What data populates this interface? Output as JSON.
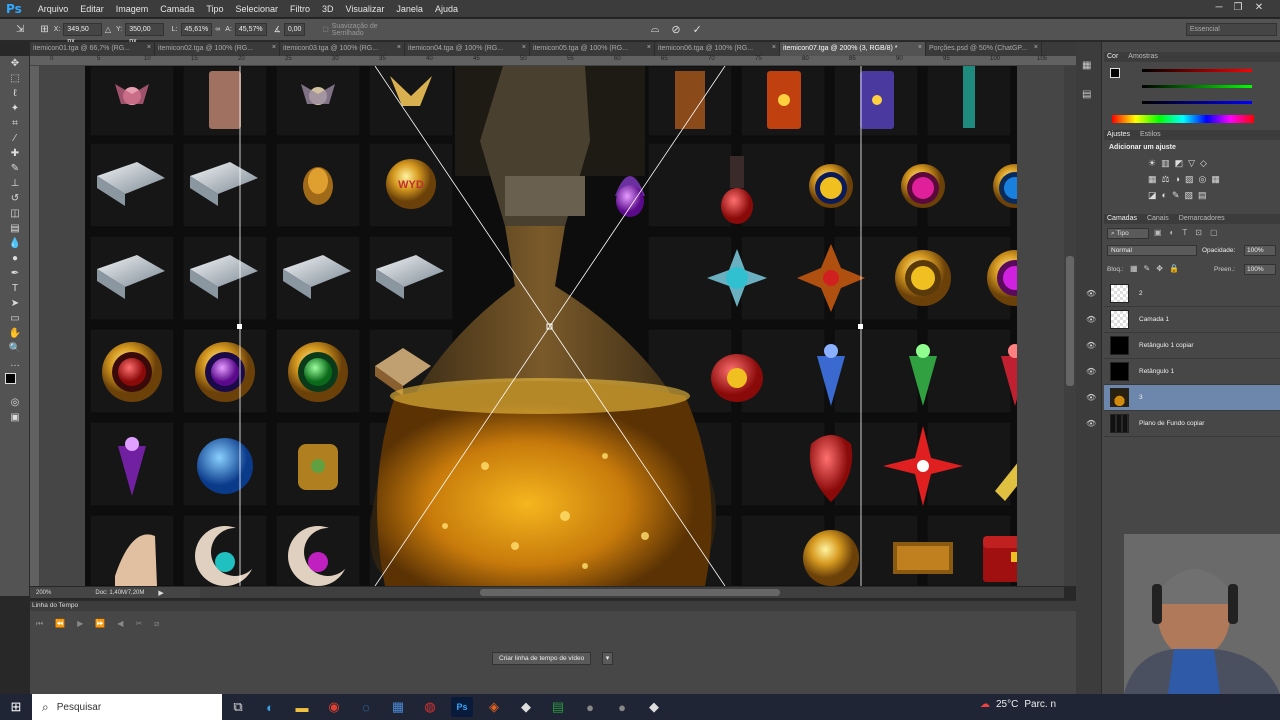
{
  "app": {
    "logo": "Ps",
    "accent": "#31a8ff"
  },
  "menu": [
    "Arquivo",
    "Editar",
    "Imagem",
    "Camada",
    "Tipo",
    "Selecionar",
    "Filtro",
    "3D",
    "Visualizar",
    "Janela",
    "Ajuda"
  ],
  "options": {
    "x_label": "X:",
    "x_value": "349,50 px",
    "y_label": "Y:",
    "y_value": "350,00 px",
    "w_label": "L:",
    "w_value": "45,61%",
    "h_label": "A:",
    "h_value": "45,57%",
    "angle_value": "0,00",
    "antialias_label": "Suavização de Serrilhado",
    "workspace": "Essencial"
  },
  "tabs": [
    {
      "label": "itemicon01.tga @ 66,7% (RG..."
    },
    {
      "label": "itemicon02.tga @ 100% (RG..."
    },
    {
      "label": "itemicon03.tga @ 100% (RG..."
    },
    {
      "label": "itemicon04.tga @ 100% (RG..."
    },
    {
      "label": "itemicon05.tga @ 100% (RG..."
    },
    {
      "label": "itemicon06.tga @ 100% (RG..."
    },
    {
      "label": "itemicon07.tga @ 200% (3, RGB/8) *"
    },
    {
      "label": "Porções.psd @ 50% (ChatGP..."
    }
  ],
  "ruler_marks": [
    "0",
    "5",
    "10",
    "15",
    "20",
    "25",
    "30",
    "35",
    "40",
    "45",
    "50",
    "55",
    "60",
    "65",
    "70",
    "75",
    "80",
    "85",
    "90",
    "95",
    "100",
    "105"
  ],
  "status": {
    "zoom": "200%",
    "doc": "Doc: 1,40M/7,20M"
  },
  "timeline": {
    "title": "Linha do Tempo",
    "button": "Criar linha de tempo de vídeo"
  },
  "panels": {
    "color_tabs": [
      "Cor",
      "Amostras"
    ],
    "adjust_tabs": [
      "Ajustes",
      "Estilos"
    ],
    "adjust_title": "Adicionar um ajuste",
    "layer_tabs": [
      "Camadas",
      "Canais",
      "Demarcadores"
    ],
    "kind_filter": "Tipo",
    "blend_mode": "Normal",
    "opacity_label": "Opacidade:",
    "opacity_value": "100%",
    "lock_label": "Bloq.:",
    "fill_label": "Preen.:",
    "fill_value": "100%"
  },
  "layers": [
    {
      "name": "2"
    },
    {
      "name": "Camada 1"
    },
    {
      "name": "Retângulo 1 copiar"
    },
    {
      "name": "Retângulo 1"
    },
    {
      "name": "3"
    },
    {
      "name": "Plano de Fundo copiar"
    }
  ],
  "taskbar": {
    "search": "Pesquisar",
    "weather": "25°C",
    "weather_text": "Parc. n"
  },
  "colors": {
    "selected_layer": "#6d86ab",
    "menubar": "#3c3c3c",
    "panel": "#535353"
  }
}
